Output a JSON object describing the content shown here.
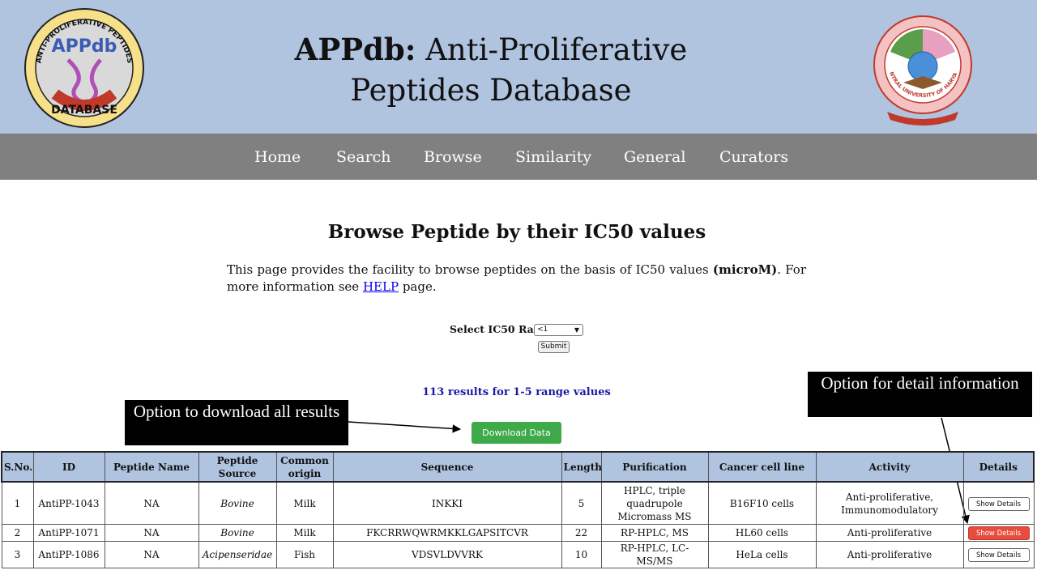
{
  "header": {
    "title_bold": "APPdb:",
    "title_rest": " Anti-Proliferative Peptides Database",
    "logo_left": {
      "icon": "appdb-logo",
      "arc_text": "ANTI-PROLIFERATIVE PEPTIDES",
      "center_text": "APPdb",
      "bottom_text": "DATABASE"
    },
    "logo_right": {
      "icon": "university-seal",
      "arc_text": "CENTRAL UNIVERSITY OF HARYANA"
    }
  },
  "nav": {
    "items": [
      "Home",
      "Search",
      "Browse",
      "Similarity",
      "General",
      "Curators"
    ]
  },
  "main": {
    "heading": "Browse Peptide by their IC50 values",
    "intro_before": "This page provides the facility to browse peptides on the basis of IC50 values ",
    "intro_bold": "(microM)",
    "intro_after": ". For more information see ",
    "help_link": "HELP",
    "intro_end": " page.",
    "form": {
      "label": "Select IC50 Range",
      "selected": "<1",
      "submit": "Submit"
    },
    "results_count": "113 results for 1-5 range values",
    "download_label": "Download Data"
  },
  "annotations": {
    "download": "Option to download all results",
    "detail": "Option for detail information"
  },
  "table": {
    "headers": [
      "S.No.",
      "ID",
      "Peptide Name",
      "Peptide Source",
      "Common origin",
      "Sequence",
      "Length",
      "Purification",
      "Cancer cell line",
      "Activity",
      "Details"
    ],
    "rows": [
      {
        "sno": "1",
        "id": "AntiPP-1043",
        "name": "NA",
        "source": "Bovine",
        "origin": "Milk",
        "sequence": "INKKI",
        "length": "5",
        "purification": "HPLC, triple quadrupole Micromass MS",
        "cell_line": "B16F10 cells",
        "activity": "Anti-proliferative, Immunomodulatory",
        "details": "Show Details"
      },
      {
        "sno": "2",
        "id": "AntiPP-1071",
        "name": "NA",
        "source": "Bovine",
        "origin": "Milk",
        "sequence": "FKCRRWQWRMKKLGAPSITCVR",
        "length": "22",
        "purification": "RP-HPLC, MS",
        "cell_line": "HL60 cells",
        "activity": "Anti-proliferative",
        "details": "Show Details"
      },
      {
        "sno": "3",
        "id": "AntiPP-1086",
        "name": "NA",
        "source": "Acipenseridae",
        "origin": "Fish",
        "sequence": "VDSVLDVVRK",
        "length": "10",
        "purification": "RP-HPLC, LC-MS/MS",
        "cell_line": "HeLa cells",
        "activity": "Anti-proliferative",
        "details": "Show Details"
      }
    ]
  },
  "colors": {
    "header_bg": "#b0c3df",
    "nav_bg": "#808080",
    "download_btn": "#3faa4a",
    "active_details_btn": "#e94b3c",
    "results_text": "#1a1aa6"
  }
}
